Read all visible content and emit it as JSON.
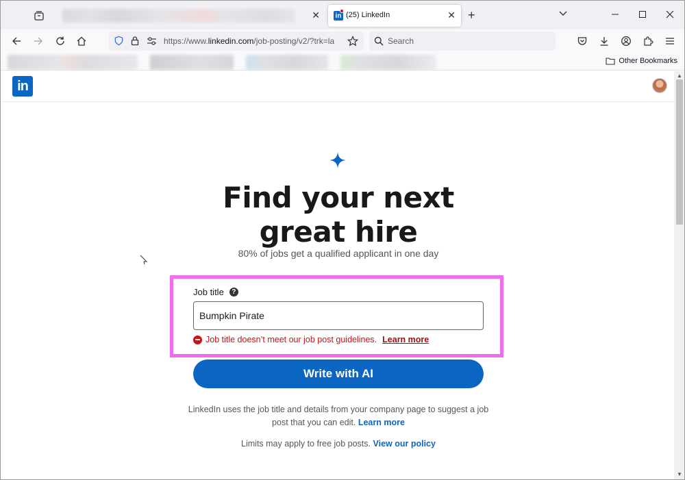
{
  "browser": {
    "tabs": [
      {
        "label": "",
        "active": false
      },
      {
        "label": "(25) LinkedIn",
        "active": true,
        "favicon": "linkedin-icon"
      }
    ],
    "url": {
      "prefix": "https://www.",
      "domain": "linkedin.com",
      "path": "/job-posting/v2/?trk=la"
    },
    "search_placeholder": "Search",
    "bookmarks": {
      "other_label": "Other Bookmarks"
    }
  },
  "page": {
    "logo_text": "in",
    "headline_line1": "Find your next",
    "headline_line2": "great hire",
    "subtitle": "80% of jobs get a qualified applicant in one day",
    "form": {
      "job_title_label": "Job title",
      "help_glyph": "?",
      "job_title_value": "Bumpkin Pirate",
      "error_text": "Job title doesn’t meet our job post guidelines.",
      "error_link": "Learn more"
    },
    "write_ai_label": "Write with AI",
    "info_text": "LinkedIn uses the job title and details from your company page to suggest a job post that you can edit.",
    "info_link": "Learn more",
    "limits_text": "Limits may apply to free job posts.",
    "limits_link": "View our policy"
  },
  "colors": {
    "brand": "#0a66c2",
    "error": "#cc1016",
    "highlight": "#f06cf0"
  }
}
